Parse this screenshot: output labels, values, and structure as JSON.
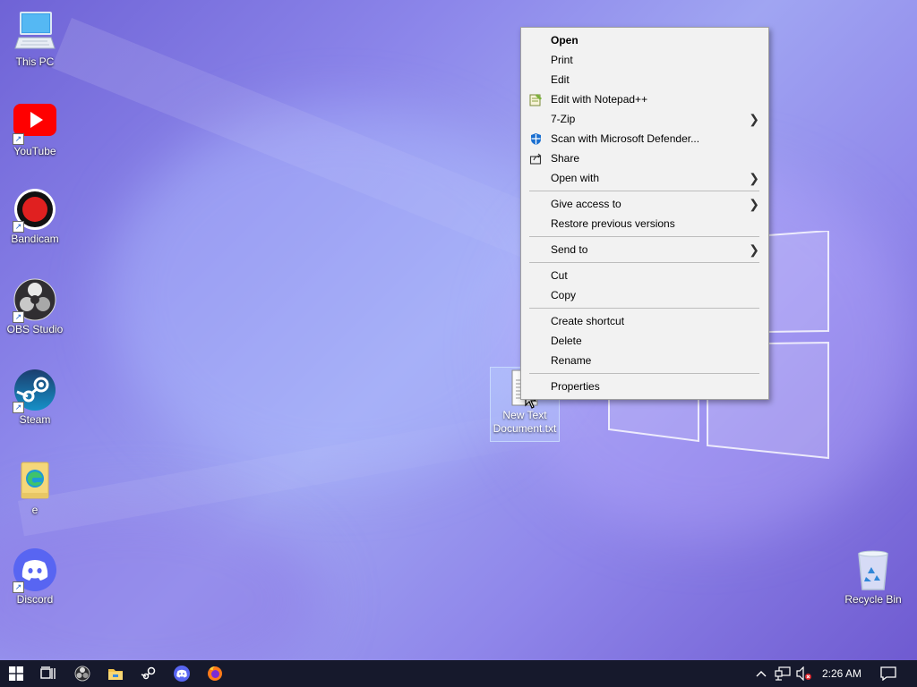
{
  "desktop_icons": [
    {
      "label": "This PC",
      "icon": "computer-icon",
      "shortcut": false
    },
    {
      "label": "YouTube",
      "icon": "youtube-icon",
      "shortcut": true
    },
    {
      "label": "Bandicam",
      "icon": "bandicam-icon",
      "shortcut": true
    },
    {
      "label": "OBS Studio",
      "icon": "obs-icon",
      "shortcut": true
    },
    {
      "label": "Steam",
      "icon": "steam-icon",
      "shortcut": true
    },
    {
      "label": "e",
      "icon": "edge-folder-icon",
      "shortcut": false
    },
    {
      "label": "Discord",
      "icon": "discord-icon",
      "shortcut": true
    }
  ],
  "recycle_bin": {
    "label": "Recycle Bin",
    "icon": "recycle-bin-icon"
  },
  "selected_file": {
    "label_line1": "New Text",
    "label_line2": "Document.txt",
    "icon": "text-document-icon"
  },
  "context_menu": {
    "items": [
      {
        "label": "Open",
        "bold": true
      },
      {
        "label": "Print"
      },
      {
        "label": "Edit"
      },
      {
        "label": "Edit with Notepad++",
        "icon": "notepad-plus-plus-icon"
      },
      {
        "label": "7-Zip",
        "submenu": true
      },
      {
        "label": "Scan with Microsoft Defender...",
        "icon": "defender-shield-icon"
      },
      {
        "label": "Share",
        "icon": "share-icon"
      },
      {
        "label": "Open with",
        "submenu": true
      },
      {
        "label": "Give access to",
        "submenu": true
      },
      {
        "label": "Restore previous versions"
      },
      {
        "label": "Send to",
        "submenu": true
      },
      {
        "label": "Cut"
      },
      {
        "label": "Copy"
      },
      {
        "label": "Create shortcut"
      },
      {
        "label": "Delete"
      },
      {
        "label": "Rename"
      },
      {
        "label": "Properties"
      }
    ]
  },
  "taskbar": {
    "items": [
      "start-icon",
      "task-view-icon",
      "obs-icon",
      "file-explorer-icon",
      "steam-icon",
      "discord-icon",
      "firefox-icon"
    ],
    "tray": [
      "chevron-up-icon",
      "network-icon",
      "volume-muted-icon"
    ],
    "clock": "2:26 AM",
    "notification": "notification-icon"
  },
  "colors": {
    "taskbar": "#16192c",
    "menu_bg": "#f2f2f2",
    "accent": "#0a5fd6"
  }
}
